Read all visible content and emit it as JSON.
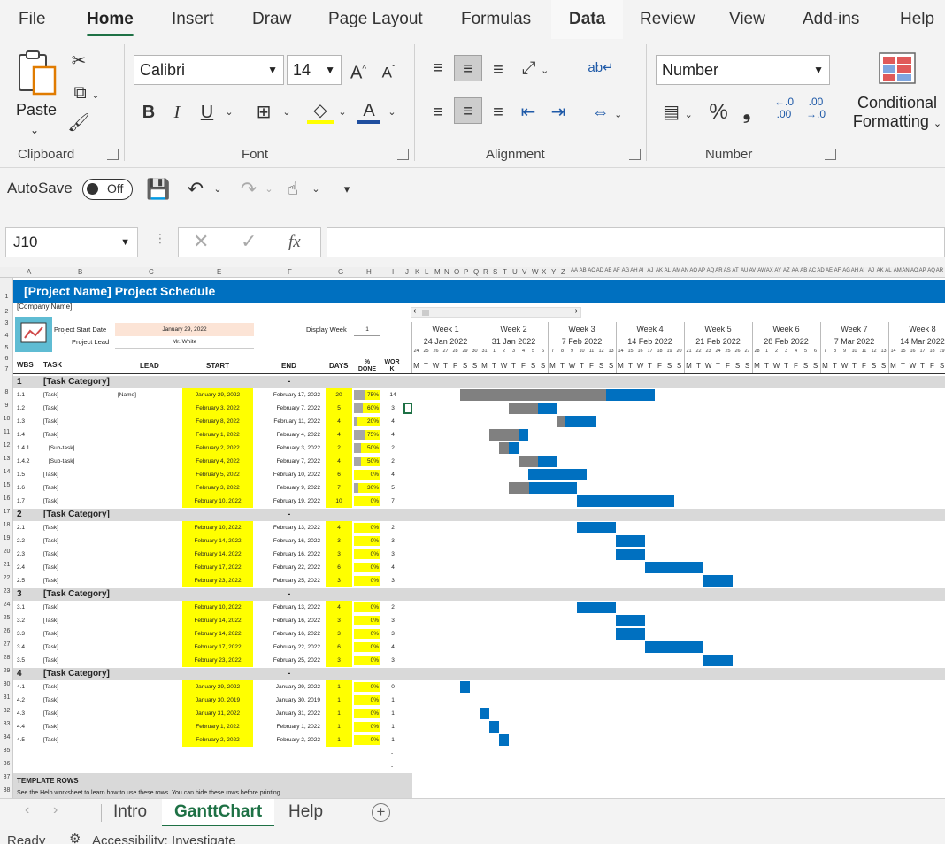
{
  "menu": {
    "tabs": [
      "File",
      "Home",
      "Insert",
      "Draw",
      "Page Layout",
      "Formulas",
      "Data",
      "Review",
      "View",
      "Add-ins",
      "Help"
    ]
  },
  "ribbon": {
    "clipboard": {
      "label": "Clipboard",
      "paste": "Paste"
    },
    "font": {
      "label": "Font",
      "name": "Calibri",
      "size": "14",
      "bold": "B",
      "italic": "I",
      "underline": "U"
    },
    "alignment": {
      "label": "Alignment"
    },
    "number": {
      "label": "Number",
      "format": "Number",
      "percent": "%",
      "comma": "❟",
      "inc_dec": "←.0 .00",
      "dec_dec": ".00 →.0"
    },
    "styles": {
      "conditional": "Conditional",
      "formatting": "Formatting"
    }
  },
  "qat": {
    "autosave": "AutoSave",
    "toggle": "Off"
  },
  "formula": {
    "namebox": "J10",
    "fx": "fx",
    "value": ""
  },
  "sheet": {
    "title": "[Project Name] Project Schedule",
    "company": "[Company Name]",
    "start_label": "Project Start Date",
    "start_value": "January 29, 2022",
    "lead_label": "Project Lead",
    "lead_value": "Mr. White",
    "display_week_label": "Display Week",
    "display_week_value": "1",
    "headers": {
      "wbs": "WBS",
      "task": "TASK",
      "lead": "LEAD",
      "start": "START",
      "end": "END",
      "days": "DAYS",
      "done": "% DONE",
      "work": "WOR K"
    },
    "weeks": [
      {
        "label": "Week 1",
        "date": "24 Jan 2022"
      },
      {
        "label": "Week 2",
        "date": "31 Jan 2022"
      },
      {
        "label": "Week 3",
        "date": "7 Feb 2022"
      },
      {
        "label": "Week 4",
        "date": "14 Feb 2022"
      },
      {
        "label": "Week 5",
        "date": "21 Feb 2022"
      },
      {
        "label": "Week 6",
        "date": "28 Feb 2022"
      },
      {
        "label": "Week 7",
        "date": "7 Mar 2022"
      },
      {
        "label": "Week 8",
        "date": "14 Mar 2022"
      }
    ],
    "day_letters": [
      "M",
      "T",
      "W",
      "T",
      "F",
      "S",
      "S"
    ],
    "categories": [
      {
        "num": "1",
        "label": "[Task Category]",
        "dash": "-",
        "tasks": [
          {
            "wbs": "1.1",
            "task": "[Task]",
            "lead": "[Name]",
            "start": "January 29, 2022",
            "end": "February 17, 2022",
            "days": "20",
            "done": "75%",
            "pct": 0.75,
            "work": "14",
            "bar_start": 5,
            "bar_len": 20
          },
          {
            "wbs": "1.2",
            "task": "[Task]",
            "lead": "",
            "start": "February 3, 2022",
            "end": "February 7, 2022",
            "days": "5",
            "done": "60%",
            "pct": 0.6,
            "work": "3",
            "bar_start": 10,
            "bar_len": 5
          },
          {
            "wbs": "1.3",
            "task": "[Task]",
            "lead": "",
            "start": "February 8, 2022",
            "end": "February 11, 2022",
            "days": "4",
            "done": "20%",
            "pct": 0.2,
            "work": "4",
            "bar_start": 15,
            "bar_len": 4
          },
          {
            "wbs": "1.4",
            "task": "[Task]",
            "lead": "",
            "start": "February 1, 2022",
            "end": "February 4, 2022",
            "days": "4",
            "done": "75%",
            "pct": 0.75,
            "work": "4",
            "bar_start": 8,
            "bar_len": 4
          },
          {
            "wbs": "1.4.1",
            "task": "[Sub-task]",
            "lead": "",
            "start": "February 2, 2022",
            "end": "February 3, 2022",
            "days": "2",
            "done": "50%",
            "pct": 0.5,
            "work": "2",
            "bar_start": 9,
            "bar_len": 2
          },
          {
            "wbs": "1.4.2",
            "task": "[Sub-task]",
            "lead": "",
            "start": "February 4, 2022",
            "end": "February 7, 2022",
            "days": "4",
            "done": "50%",
            "pct": 0.5,
            "work": "2",
            "bar_start": 11,
            "bar_len": 4
          },
          {
            "wbs": "1.5",
            "task": "[Task]",
            "lead": "",
            "start": "February 5, 2022",
            "end": "February 10, 2022",
            "days": "6",
            "done": "0%",
            "pct": 0,
            "work": "4",
            "bar_start": 12,
            "bar_len": 6
          },
          {
            "wbs": "1.6",
            "task": "[Task]",
            "lead": "",
            "start": "February 3, 2022",
            "end": "February 9, 2022",
            "days": "7",
            "done": "30%",
            "pct": 0.3,
            "work": "5",
            "bar_start": 10,
            "bar_len": 7
          },
          {
            "wbs": "1.7",
            "task": "[Task]",
            "lead": "",
            "start": "February 10, 2022",
            "end": "February 19, 2022",
            "days": "10",
            "done": "0%",
            "pct": 0,
            "work": "7",
            "bar_start": 17,
            "bar_len": 10
          }
        ]
      },
      {
        "num": "2",
        "label": "[Task Category]",
        "dash": "-",
        "tasks": [
          {
            "wbs": "2.1",
            "task": "[Task]",
            "lead": "",
            "start": "February 10, 2022",
            "end": "February 13, 2022",
            "days": "4",
            "done": "0%",
            "pct": 0,
            "work": "2",
            "bar_start": 17,
            "bar_len": 4
          },
          {
            "wbs": "2.2",
            "task": "[Task]",
            "lead": "",
            "start": "February 14, 2022",
            "end": "February 16, 2022",
            "days": "3",
            "done": "0%",
            "pct": 0,
            "work": "3",
            "bar_start": 21,
            "bar_len": 3
          },
          {
            "wbs": "2.3",
            "task": "[Task]",
            "lead": "",
            "start": "February 14, 2022",
            "end": "February 16, 2022",
            "days": "3",
            "done": "0%",
            "pct": 0,
            "work": "3",
            "bar_start": 21,
            "bar_len": 3
          },
          {
            "wbs": "2.4",
            "task": "[Task]",
            "lead": "",
            "start": "February 17, 2022",
            "end": "February 22, 2022",
            "days": "6",
            "done": "0%",
            "pct": 0,
            "work": "4",
            "bar_start": 24,
            "bar_len": 6
          },
          {
            "wbs": "2.5",
            "task": "[Task]",
            "lead": "",
            "start": "February 23, 2022",
            "end": "February 25, 2022",
            "days": "3",
            "done": "0%",
            "pct": 0,
            "work": "3",
            "bar_start": 30,
            "bar_len": 3
          }
        ]
      },
      {
        "num": "3",
        "label": "[Task Category]",
        "dash": "-",
        "tasks": [
          {
            "wbs": "3.1",
            "task": "[Task]",
            "lead": "",
            "start": "February 10, 2022",
            "end": "February 13, 2022",
            "days": "4",
            "done": "0%",
            "pct": 0,
            "work": "2",
            "bar_start": 17,
            "bar_len": 4
          },
          {
            "wbs": "3.2",
            "task": "[Task]",
            "lead": "",
            "start": "February 14, 2022",
            "end": "February 16, 2022",
            "days": "3",
            "done": "0%",
            "pct": 0,
            "work": "3",
            "bar_start": 21,
            "bar_len": 3
          },
          {
            "wbs": "3.3",
            "task": "[Task]",
            "lead": "",
            "start": "February 14, 2022",
            "end": "February 16, 2022",
            "days": "3",
            "done": "0%",
            "pct": 0,
            "work": "3",
            "bar_start": 21,
            "bar_len": 3
          },
          {
            "wbs": "3.4",
            "task": "[Task]",
            "lead": "",
            "start": "February 17, 2022",
            "end": "February 22, 2022",
            "days": "6",
            "done": "0%",
            "pct": 0,
            "work": "4",
            "bar_start": 24,
            "bar_len": 6
          },
          {
            "wbs": "3.5",
            "task": "[Task]",
            "lead": "",
            "start": "February 23, 2022",
            "end": "February 25, 2022",
            "days": "3",
            "done": "0%",
            "pct": 0,
            "work": "3",
            "bar_start": 30,
            "bar_len": 3
          }
        ]
      },
      {
        "num": "4",
        "label": "[Task Category]",
        "dash": "-",
        "tasks": [
          {
            "wbs": "4.1",
            "task": "[Task]",
            "lead": "",
            "start": "January 29, 2022",
            "end": "January 29, 2022",
            "days": "1",
            "done": "0%",
            "pct": 0,
            "work": "0",
            "bar_start": 5,
            "bar_len": 1
          },
          {
            "wbs": "4.2",
            "task": "[Task]",
            "lead": "",
            "start": "January 30, 2019",
            "end": "January 30, 2019",
            "days": "1",
            "done": "0%",
            "pct": 0,
            "work": "1",
            "bar_start": -1,
            "bar_len": 0
          },
          {
            "wbs": "4.3",
            "task": "[Task]",
            "lead": "",
            "start": "January 31, 2022",
            "end": "January 31, 2022",
            "days": "1",
            "done": "0%",
            "pct": 0,
            "work": "1",
            "bar_start": 7,
            "bar_len": 1
          },
          {
            "wbs": "4.4",
            "task": "[Task]",
            "lead": "",
            "start": "February 1, 2022",
            "end": "February 1, 2022",
            "days": "1",
            "done": "0%",
            "pct": 0,
            "work": "1",
            "bar_start": 8,
            "bar_len": 1
          },
          {
            "wbs": "4.5",
            "task": "[Task]",
            "lead": "",
            "start": "February 2, 2022",
            "end": "February 2, 2022",
            "days": "1",
            "done": "0%",
            "pct": 0,
            "work": "1",
            "bar_start": 9,
            "bar_len": 1
          }
        ]
      }
    ],
    "template_rows": "TEMPLATE ROWS",
    "template_note": "See the Help worksheet to learn how to use these rows. You can hide these rows before printing."
  },
  "sheet_tabs": [
    "Intro",
    "GanttChart",
    "Help"
  ],
  "status": {
    "ready": "Ready",
    "accessibility": "Accessibility: Investigate"
  },
  "colors": {
    "accent": "#1e7145",
    "title_blue": "#0070c0",
    "highlight": "#ffff00"
  }
}
